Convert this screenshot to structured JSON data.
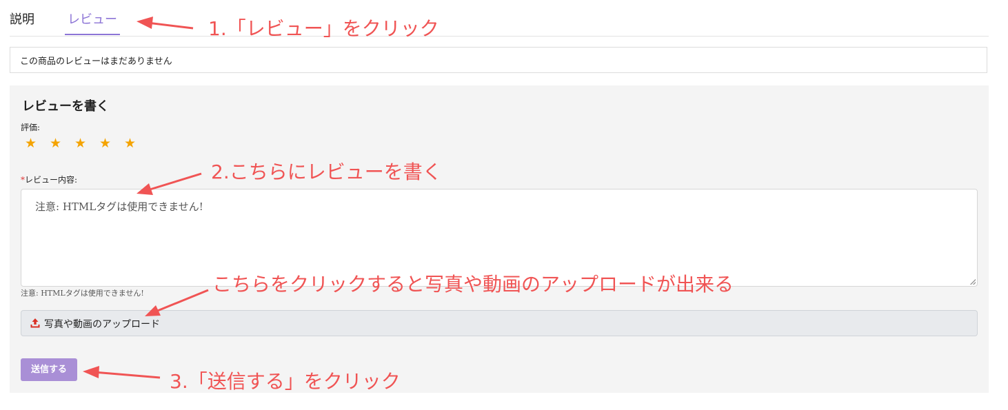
{
  "tabs": {
    "description": "説明",
    "review": "レビュー"
  },
  "no_review_message": "この商品のレビューはまだありません",
  "review_form": {
    "title": "レビューを書く",
    "rating_label": "評価:",
    "stars": [
      {
        "icon": "star-icon",
        "char": "★"
      },
      {
        "icon": "star-icon",
        "char": "★"
      },
      {
        "icon": "star-icon",
        "char": "★"
      },
      {
        "icon": "star-icon",
        "char": "★"
      },
      {
        "icon": "star-icon",
        "char": "★"
      }
    ],
    "star_color": "#f4a300",
    "required_mark": "*",
    "content_label": "レビュー内容:",
    "textarea_placeholder": "注意: HTMLタグは使用できません!",
    "help_text": "注意: HTMLタグは使用できません!",
    "upload_button": "写真や動画のアップロード",
    "upload_icon": "upload-icon",
    "submit_button": "送信する"
  },
  "annotations": {
    "step1": "1.「レビュー」をクリック",
    "step2": "2.こちらにレビューを書く",
    "upload_hint": "こちらをクリックすると写真や動画のアップロードが出来る",
    "step3": "3.「送信する」をクリック",
    "color": "#f05454"
  },
  "colors": {
    "accent": "#8c74d6",
    "submit_bg": "#a98fd6",
    "panel_bg": "#f4f4f4"
  }
}
